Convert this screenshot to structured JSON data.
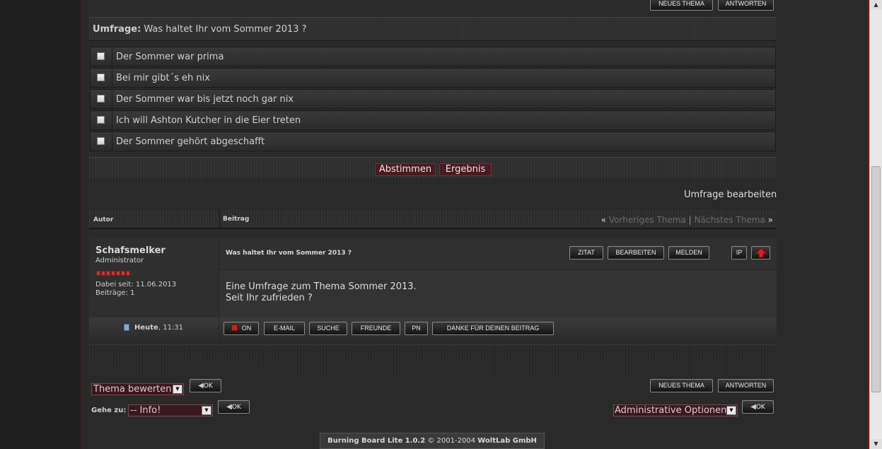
{
  "top_buttons": {
    "new_thread": "NEUES THEMA",
    "reply": "ANTWORTEN"
  },
  "poll": {
    "label": "Umfrage:",
    "question": "Was haltet Ihr vom Sommer 2013 ?",
    "options": [
      "Der Sommer war prima",
      "Bei mir gibt´s eh nix",
      "Der Sommer war bis jetzt noch gar nix",
      "Ich will Ashton Kutcher in die Eier treten",
      "Der Sommer gehört abgeschafft"
    ],
    "vote_label": "Abstimmen",
    "result_label": "Ergebnis",
    "edit_poll": "Umfrage bearbeiten"
  },
  "thread_header": {
    "author_col": "Autor",
    "post_col": "Beitrag",
    "nav_prefix": "«",
    "prev_thread": "Vorheriges Thema",
    "separator": "|",
    "next_thread": "Nächstes Thema",
    "nav_suffix": "»"
  },
  "post": {
    "author": "Schafsmelker",
    "rank": "Administrator",
    "joined": "Dabei seit: 11.06.2013",
    "posts_count": "Beiträge: 1",
    "title": "Was haltet Ihr vom Sommer 2013 ?",
    "body_line1": "Eine Umfrage zum Thema Sommer 2013.",
    "body_line2": "Seit Ihr zufrieden ?",
    "date_bold": "Heute",
    "time": ", 11:31",
    "buttons": {
      "quote": "ZITAT",
      "edit": "BEARBEITEN",
      "report": "MELDEN",
      "ip": "IP",
      "status": "ON",
      "email": "E-MAIL",
      "search": "SUCHE",
      "friends": "FREUNDE",
      "pm": "PN",
      "thanks": "DANKE FÜR DEINEN BEITRAG"
    }
  },
  "bottom": {
    "rate_thread": "Thema bewerten:",
    "ok": "OK",
    "goto_label": "Gehe zu:",
    "goto_value": "-- Info!",
    "admin_options": "Administrative Optionen:",
    "new_thread": "NEUES THEMA",
    "reply": "ANTWORTEN"
  },
  "footer": {
    "product": "Burning Board Lite 1.0.2",
    "copyright": "© 2001-2004",
    "company": "WoltLab GmbH"
  },
  "colors": {
    "accent_red": "#c43838",
    "button_maroon": "#4a1a22"
  }
}
